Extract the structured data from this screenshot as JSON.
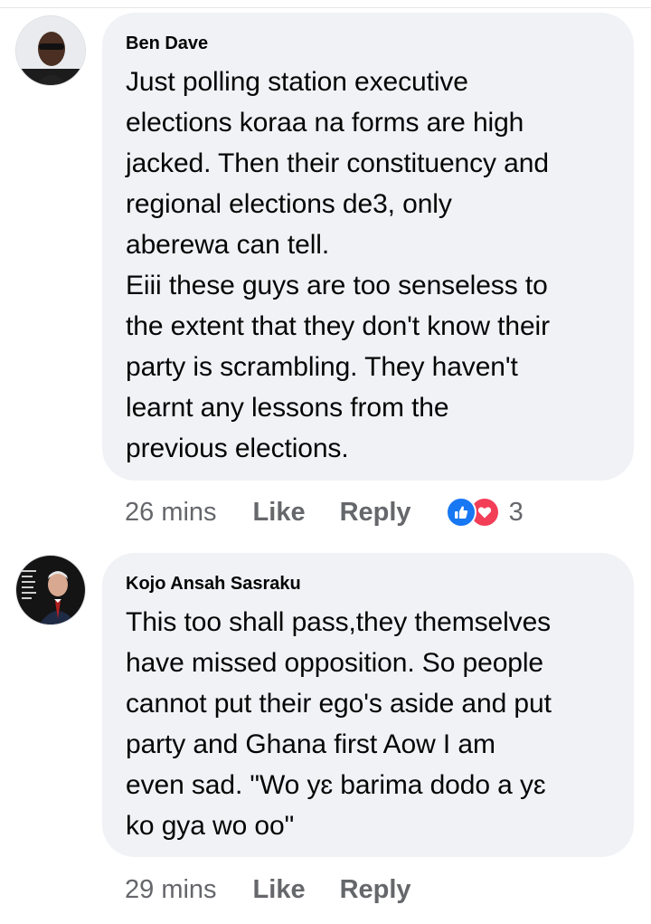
{
  "comments": [
    {
      "author": "Ben Dave",
      "text": "Just polling station executive\nelections koraa na forms are high\njacked. Then their constituency and\nregional elections de3, only\naberewa can tell.\nEiii these guys are too senseless to\nthe extent that they don't know their\nparty is scrambling. They haven't\nlearnt any lessons from the\nprevious elections.",
      "time": "26 mins",
      "like_label": "Like",
      "reply_label": "Reply",
      "reactions": [
        "like-icon",
        "love-icon"
      ],
      "reaction_count": "3"
    },
    {
      "author": "Kojo Ansah Sasraku",
      "text": "This too shall pass,they themselves\nhave missed opposition. So people\ncannot put their ego's aside and put\nparty and Ghana first Aow I am\neven sad. \"Wo yɛ barima dodo a yɛ\nko gya wo oo\"",
      "time": "29 mins",
      "like_label": "Like",
      "reply_label": "Reply"
    }
  ],
  "colors": {
    "bubble": "#f0f2f5",
    "meta_text": "#65676b",
    "like_blue": "#1877f2",
    "love_red": "#f33e58"
  }
}
